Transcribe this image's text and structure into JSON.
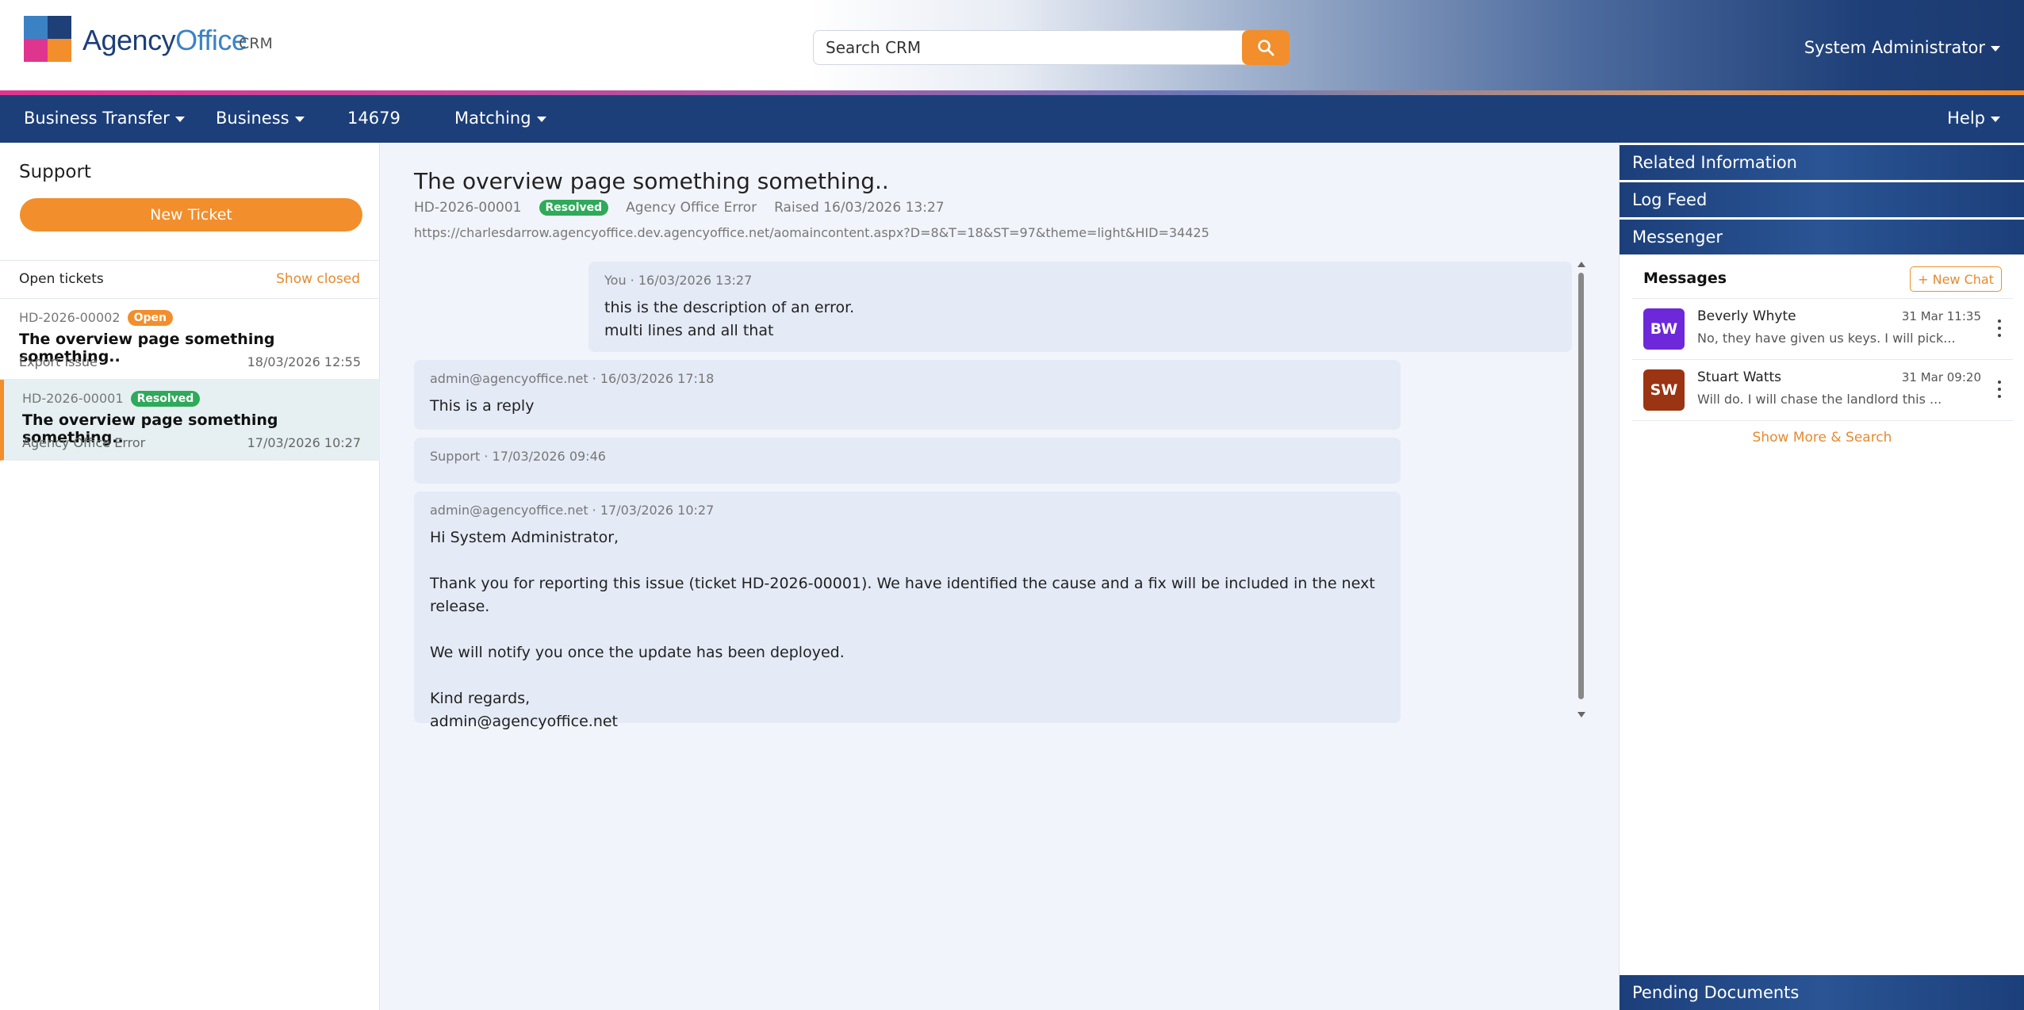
{
  "header": {
    "brand_part1": "Agency",
    "brand_part2": "Office",
    "brand_suffix": "CRM",
    "search_placeholder": "Search CRM",
    "user": "System Administrator"
  },
  "nav": {
    "items": [
      "Business Transfer",
      "Business",
      "14679",
      "Matching"
    ],
    "help": "Help"
  },
  "sidebar": {
    "title": "Support",
    "new_ticket": "New Ticket",
    "open_label": "Open tickets",
    "show_closed": "Show closed",
    "tickets": [
      {
        "id": "HD-2026-00002",
        "status": "Open",
        "title": "The overview page something something..",
        "category": "Export Issue",
        "date": "18/03/2026 12:55"
      },
      {
        "id": "HD-2026-00001",
        "status": "Resolved",
        "title": "The overview page something something..",
        "category": "Agency Office Error",
        "date": "17/03/2026 10:27"
      }
    ]
  },
  "ticket": {
    "title": "The overview page something something..",
    "id": "HD-2026-00001",
    "status": "Resolved",
    "category": "Agency Office Error",
    "raised": "Raised 16/03/2026 13:27",
    "url": "https://charlesdarrow.agencyoffice.dev.agencyoffice.net/aomaincontent.aspx?D=8&T=18&ST=97&theme=light&HID=34425",
    "messages": [
      {
        "head": "You · 16/03/2026 13:27",
        "body": "this is the description of an error.\nmulti lines and all that"
      },
      {
        "head": "admin@agencyoffice.net · 16/03/2026 17:18",
        "body": "This is a reply"
      },
      {
        "head": "Support · 17/03/2026 09:46",
        "body": ""
      },
      {
        "head": "admin@agencyoffice.net · 17/03/2026 10:27",
        "body": "Hi System Administrator,\n\nThank you for reporting this issue (ticket HD-2026-00001). We have identified the cause and a fix will be included in the next release.\n\nWe will notify you once the update has been deployed.\n\nKind regards,\nadmin@agencyoffice.net"
      }
    ]
  },
  "right": {
    "sections": [
      "Related Information",
      "Log Feed",
      "Messenger"
    ],
    "messages_title": "Messages",
    "new_chat": "+ New Chat",
    "chats": [
      {
        "initials": "BW",
        "name": "Beverly Whyte",
        "date": "31 Mar 11:35",
        "preview": "No, they have given us keys. I will pick...",
        "color": "#6d28d9"
      },
      {
        "initials": "SW",
        "name": "Stuart Watts",
        "date": "31 Mar 09:20",
        "preview": "Will do. I will chase the landlord this ...",
        "color": "#9a3412"
      }
    ],
    "show_more": "Show More & Search",
    "pending": "Pending Documents"
  },
  "colors": {
    "accent": "#f28e2b",
    "nav": "#1c3f7a",
    "resolved": "#2eaa5a"
  }
}
